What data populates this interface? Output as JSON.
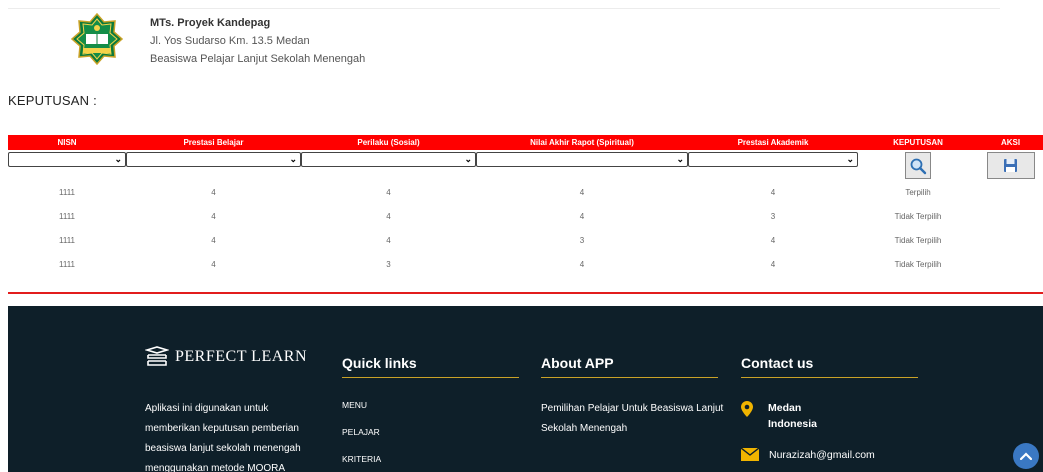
{
  "school": {
    "name": "MTs. Proyek Kandepag",
    "address": "Jl. Yos Sudarso Km. 13.5 Medan",
    "description": "Beasiswa Pelajar Lanjut Sekolah Menengah"
  },
  "page_heading": "KEPUTUSAN :",
  "table": {
    "headers": [
      "NISN",
      "Prestasi Belajar",
      "Perilaku (Sosial)",
      "Nilai Akhir Rapot (Spiritual)",
      "Prestasi Akademik",
      "KEPUTUSAN",
      "AKSI"
    ],
    "rows": [
      [
        "1111",
        "4",
        "4",
        "4",
        "4",
        "Terpilih"
      ],
      [
        "1111",
        "4",
        "4",
        "4",
        "3",
        "Tidak Terpilih"
      ],
      [
        "1111",
        "4",
        "4",
        "3",
        "4",
        "Tidak Terpilih"
      ],
      [
        "1111",
        "4",
        "3",
        "4",
        "4",
        "Tidak Terpilih"
      ]
    ]
  },
  "footer": {
    "brand": "PERFECT LEARN",
    "about_text": "Aplikasi ini digunakan untuk memberikan keputusan pemberian beasiswa lanjut sekolah menengah menggunakan metode MOORA",
    "quick_links_title": "Quick links",
    "quick_links": [
      "MENU",
      "PELAJAR",
      "KRITERIA"
    ],
    "about_title": "About APP",
    "about_app_text": "Pemilihan Pelajar Untuk Beasiswa Lanjut Sekolah Menengah",
    "contact_title": "Contact us",
    "contact_city": "Medan",
    "contact_country": "Indonesia",
    "contact_email": "Nurazizah@gmail.com"
  },
  "colors": {
    "header_red": "#ff0000",
    "footer_bg": "#0e1f29",
    "accent_gold": "#c9a227",
    "scroll_button": "#3a78c3"
  },
  "icons": {
    "logo": "ministry-emblem-icon",
    "search": "search-icon",
    "save": "floppy-save-icon",
    "brand": "book-stack-icon",
    "location": "map-pin-icon",
    "email": "envelope-icon",
    "scroll_top": "chevron-up-icon"
  }
}
